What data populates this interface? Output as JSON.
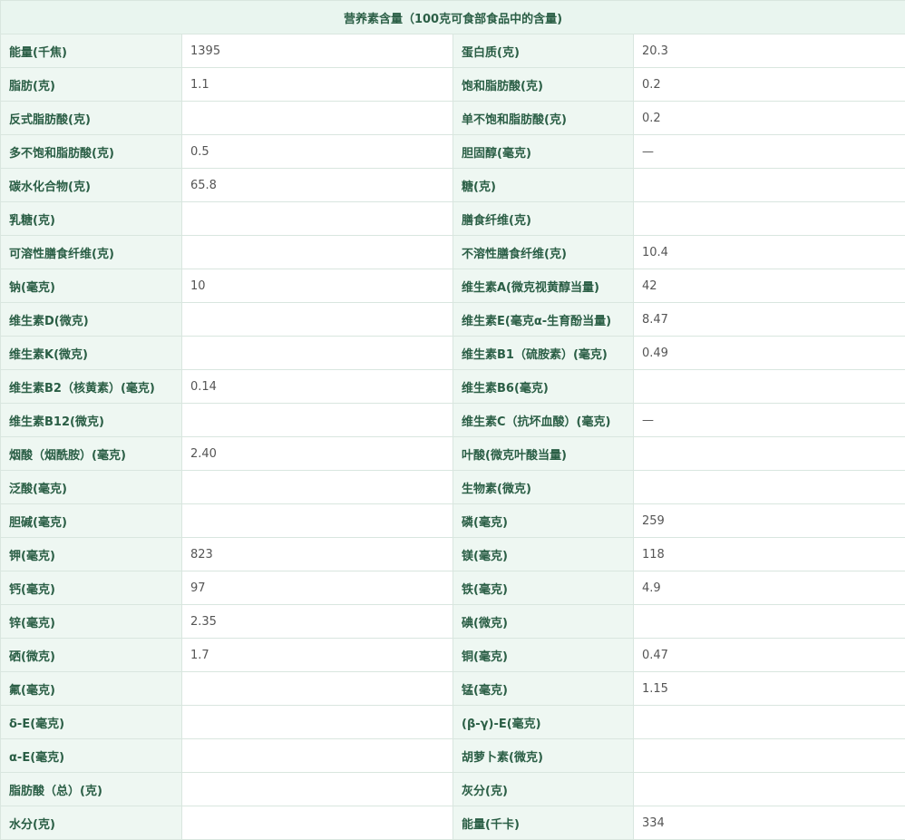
{
  "table": {
    "title": "营养素含量（100克可食部食品中的含量)",
    "rows": [
      [
        {
          "label": "能量(千焦)",
          "value": "1395"
        },
        {
          "label": "蛋白质(克)",
          "value": "20.3"
        }
      ],
      [
        {
          "label": "脂肪(克)",
          "value": "1.1"
        },
        {
          "label": "饱和脂肪酸(克)",
          "value": "0.2"
        }
      ],
      [
        {
          "label": "反式脂肪酸(克)",
          "value": ""
        },
        {
          "label": "单不饱和脂肪酸(克)",
          "value": "0.2"
        }
      ],
      [
        {
          "label": "多不饱和脂肪酸(克)",
          "value": "0.5"
        },
        {
          "label": "胆固醇(毫克)",
          "value": "—"
        }
      ],
      [
        {
          "label": "碳水化合物(克)",
          "value": "65.8"
        },
        {
          "label": "糖(克)",
          "value": ""
        }
      ],
      [
        {
          "label": "乳糖(克)",
          "value": ""
        },
        {
          "label": "膳食纤维(克)",
          "value": ""
        }
      ],
      [
        {
          "label": "可溶性膳食纤维(克)",
          "value": ""
        },
        {
          "label": "不溶性膳食纤维(克)",
          "value": "10.4"
        }
      ],
      [
        {
          "label": "钠(毫克)",
          "value": "10"
        },
        {
          "label": "维生素A(微克视黄醇当量)",
          "value": "42"
        }
      ],
      [
        {
          "label": "维生素D(微克)",
          "value": ""
        },
        {
          "label": "维生素E(毫克α-生育酚当量)",
          "value": "8.47"
        }
      ],
      [
        {
          "label": "维生素K(微克)",
          "value": ""
        },
        {
          "label": "维生素B1（硫胺素）(毫克)",
          "value": "0.49"
        }
      ],
      [
        {
          "label": "维生素B2（核黄素）(毫克)",
          "value": "0.14"
        },
        {
          "label": "维生素B6(毫克)",
          "value": ""
        }
      ],
      [
        {
          "label": "维生素B12(微克)",
          "value": ""
        },
        {
          "label": "维生素C（抗坏血酸）(毫克)",
          "value": "—"
        }
      ],
      [
        {
          "label": "烟酸（烟酰胺）(毫克)",
          "value": "2.40"
        },
        {
          "label": "叶酸(微克叶酸当量)",
          "value": ""
        }
      ],
      [
        {
          "label": "泛酸(毫克)",
          "value": ""
        },
        {
          "label": "生物素(微克)",
          "value": ""
        }
      ],
      [
        {
          "label": "胆碱(毫克)",
          "value": ""
        },
        {
          "label": "磷(毫克)",
          "value": "259"
        }
      ],
      [
        {
          "label": "钾(毫克)",
          "value": "823"
        },
        {
          "label": "镁(毫克)",
          "value": "118"
        }
      ],
      [
        {
          "label": "钙(毫克)",
          "value": "97"
        },
        {
          "label": "铁(毫克)",
          "value": "4.9"
        }
      ],
      [
        {
          "label": "锌(毫克)",
          "value": "2.35"
        },
        {
          "label": "碘(微克)",
          "value": ""
        }
      ],
      [
        {
          "label": "硒(微克)",
          "value": "1.7"
        },
        {
          "label": "铜(毫克)",
          "value": "0.47"
        }
      ],
      [
        {
          "label": "氟(毫克)",
          "value": ""
        },
        {
          "label": "锰(毫克)",
          "value": "1.15"
        }
      ],
      [
        {
          "label": "δ-E(毫克)",
          "value": ""
        },
        {
          "label": "(β-γ)-E(毫克)",
          "value": ""
        }
      ],
      [
        {
          "label": "α-E(毫克)",
          "value": ""
        },
        {
          "label": "胡萝卜素(微克)",
          "value": ""
        }
      ],
      [
        {
          "label": "脂肪酸（总）(克)",
          "value": ""
        },
        {
          "label": "灰分(克)",
          "value": ""
        }
      ],
      [
        {
          "label": "水分(克)",
          "value": ""
        },
        {
          "label": "能量(千卡)",
          "value": "334"
        }
      ]
    ]
  }
}
